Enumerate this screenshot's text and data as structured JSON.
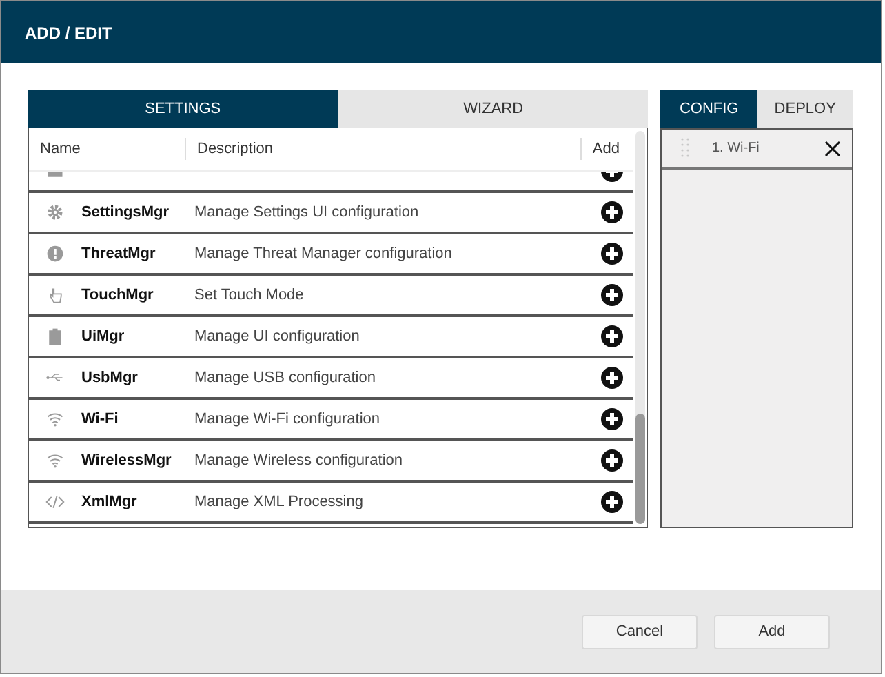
{
  "window": {
    "title": "ADD / EDIT"
  },
  "tabs": [
    {
      "label": "SETTINGS",
      "selected": true
    },
    {
      "label": "WIZARD",
      "selected": false
    }
  ],
  "table": {
    "columns": [
      "Name",
      "Description",
      "Add"
    ],
    "rows": [
      {
        "kind": "card",
        "name": "",
        "description": "",
        "partial": true
      },
      {
        "kind": "gear",
        "name": "SettingsMgr",
        "description": "Manage Settings UI configuration"
      },
      {
        "kind": "alert",
        "name": "ThreatMgr",
        "description": "Manage Threat Manager configuration"
      },
      {
        "kind": "hand",
        "name": "TouchMgr",
        "description": "Set Touch Mode"
      },
      {
        "kind": "clipboard",
        "name": "UiMgr",
        "description": "Manage UI configuration"
      },
      {
        "kind": "usb",
        "name": "UsbMgr",
        "description": "Manage USB configuration"
      },
      {
        "kind": "wifi",
        "name": "Wi-Fi",
        "description": "Manage Wi-Fi configuration"
      },
      {
        "kind": "wifi",
        "name": "WirelessMgr",
        "description": "Manage Wireless configuration"
      },
      {
        "kind": "code",
        "name": "XmlMgr",
        "description": "Manage XML Processing"
      }
    ]
  },
  "side_tabs": [
    {
      "label": "CONFIG",
      "selected": true
    },
    {
      "label": "DEPLOY",
      "selected": false
    }
  ],
  "config_items": [
    {
      "label": "1. Wi-Fi"
    }
  ],
  "buttons": [
    "Cancel",
    "Add"
  ]
}
